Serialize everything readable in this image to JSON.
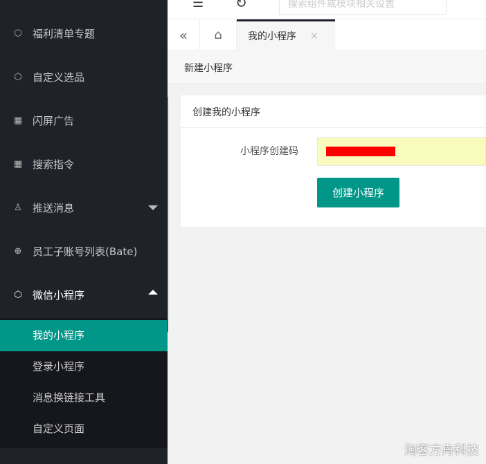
{
  "sidebar": {
    "items": [
      {
        "label": "福利清单专题",
        "icon": "cube-icon"
      },
      {
        "label": "自定义选品",
        "icon": "cube-icon"
      },
      {
        "label": "闪屏广告",
        "icon": "apps-icon"
      },
      {
        "label": "搜索指令",
        "icon": "apps-icon"
      },
      {
        "label": "推送消息",
        "icon": "user-icon"
      },
      {
        "label": "员工子账号列表(Bate)",
        "icon": "globe-icon"
      },
      {
        "label": "微信小程序",
        "icon": "cube-icon"
      }
    ],
    "submenu": [
      {
        "label": "我的小程序"
      },
      {
        "label": "登录小程序"
      },
      {
        "label": "消息换链接工具"
      },
      {
        "label": "自定义页面"
      }
    ]
  },
  "header": {
    "search_placeholder": "搜索组件或模块相关设置"
  },
  "tabs": {
    "active": "我的小程序"
  },
  "breadcrumb": "新建小程序",
  "card": {
    "title": "创建我的小程序",
    "field_label": "小程序创建码",
    "submit": "创建小程序"
  },
  "watermark": "淘客方舟科技",
  "colors": {
    "accent": "#009688",
    "sidebar": "#20222a"
  }
}
